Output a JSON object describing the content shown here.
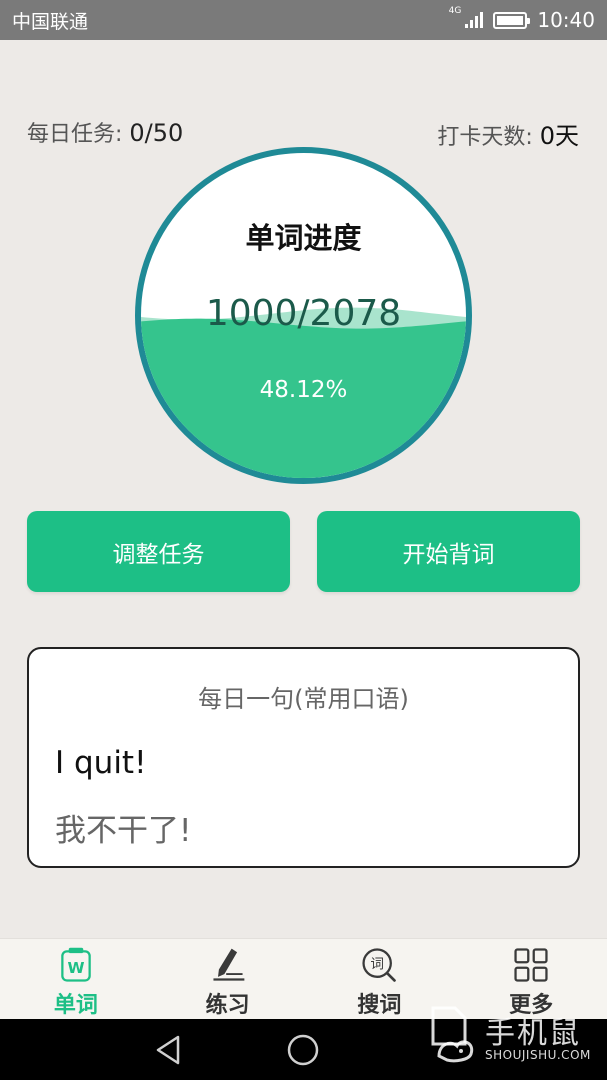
{
  "status_bar": {
    "carrier": "中国联通",
    "network": "4G",
    "time": "10:40",
    "battery_level": 1.0
  },
  "stats": {
    "daily_task_label": "每日任务: ",
    "daily_task_value": "0/50",
    "checkin_label": "打卡天数: ",
    "checkin_value": "0天"
  },
  "progress": {
    "title": "单词进度",
    "count": "1000/2078",
    "percent": "48.12%",
    "fraction": 0.4812
  },
  "buttons": {
    "adjust_task": "调整任务",
    "start_study": "开始背词"
  },
  "daily_sentence": {
    "title": "每日一句(常用口语)",
    "english": "I quit!",
    "chinese": "我不干了!"
  },
  "bottom_nav": {
    "items": [
      {
        "label": "单词",
        "icon": "word-card-icon",
        "active": true
      },
      {
        "label": "练习",
        "icon": "pencil-icon",
        "active": false
      },
      {
        "label": "搜词",
        "icon": "search-word-icon",
        "active": false
      },
      {
        "label": "更多",
        "icon": "grid-icon",
        "active": false
      }
    ]
  },
  "system_bar": {
    "back": "back-icon",
    "home": "home-icon"
  },
  "watermark": {
    "brand": "手机鼠",
    "url": "SHOUJISHU.COM"
  },
  "colors": {
    "accent": "#1dbf86",
    "ring": "#1f8a96",
    "water": "#35c48d",
    "water_light": "#85d9b8"
  }
}
